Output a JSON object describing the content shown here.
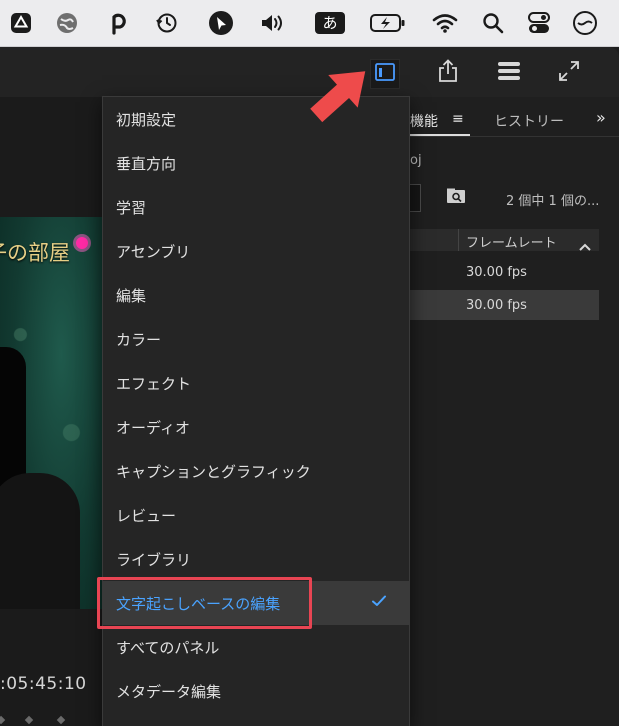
{
  "menubar": {
    "icons": [
      "google-drive-icon",
      "globe-icon",
      "p-app-icon",
      "time-machine-icon",
      "cursor-app-icon",
      "volume-icon",
      "input-method-icon",
      "battery-charging-icon",
      "wifi-icon",
      "spotlight-search-icon",
      "control-center-icon",
      "account-icon"
    ],
    "ime_label": "あ"
  },
  "toolbar": {
    "buttons": [
      "workspaces-icon",
      "share-export-icon",
      "quick-export-icon",
      "fullscreen-icon"
    ],
    "active_color": "#4a9bff"
  },
  "monitor": {
    "video_title": "子の部屋",
    "timecode": ":05:45:10"
  },
  "right_panel": {
    "tab_active": "機能",
    "tab_menu_glyph": "≡",
    "tab_other": "ヒストリー",
    "overflow_glyph": "»",
    "project_name": "oj",
    "item_count": "2 個中 1 個の...",
    "column_header": "フレームレート",
    "rows": [
      {
        "frame_rate": "30.00 fps",
        "selected": false
      },
      {
        "frame_rate": "30.00 fps",
        "selected": true
      }
    ]
  },
  "workspace_menu": {
    "items": [
      {
        "label": "初期設定",
        "checked": false
      },
      {
        "label": "垂直方向",
        "checked": false
      },
      {
        "label": "学習",
        "checked": false
      },
      {
        "label": "アセンブリ",
        "checked": false
      },
      {
        "label": "編集",
        "checked": false
      },
      {
        "label": "カラー",
        "checked": false
      },
      {
        "label": "エフェクト",
        "checked": false
      },
      {
        "label": "オーディオ",
        "checked": false
      },
      {
        "label": "キャプションとグラフィック",
        "checked": false
      },
      {
        "label": "レビュー",
        "checked": false
      },
      {
        "label": "ライブラリ",
        "checked": false
      },
      {
        "label": "文字起こしベースの編集",
        "checked": true
      },
      {
        "label": "すべてのパネル",
        "checked": false
      },
      {
        "label": "メタデータ編集",
        "checked": false
      }
    ],
    "accent_color": "#4aa3ff",
    "highlight_color": "#e84553"
  }
}
